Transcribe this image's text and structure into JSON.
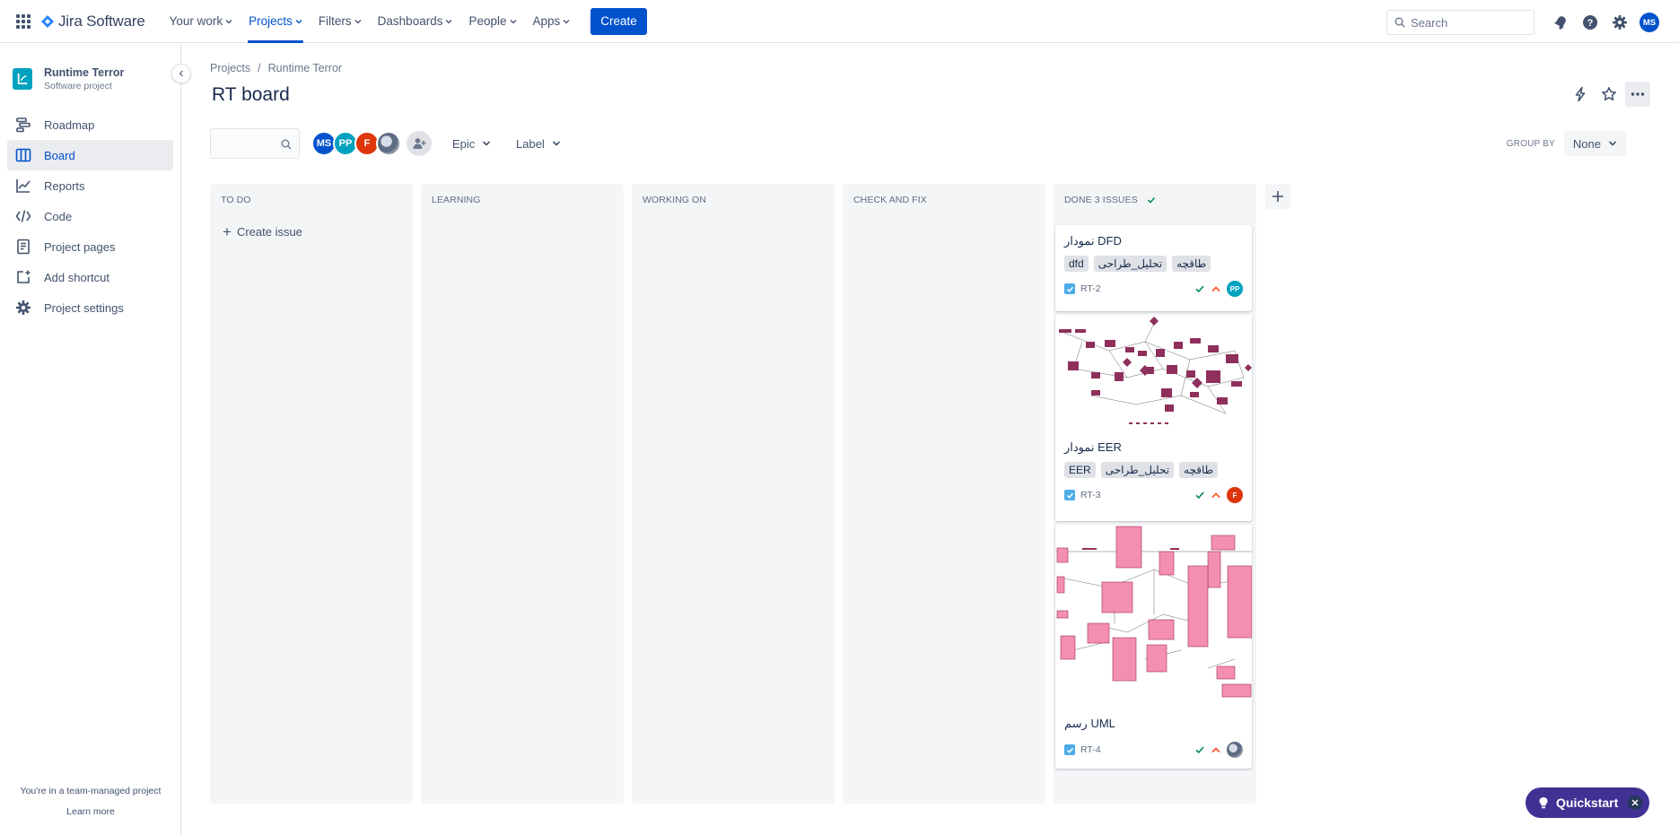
{
  "app": {
    "logo_text": "Jira Software",
    "nav": [
      {
        "label": "Your work"
      },
      {
        "label": "Projects"
      },
      {
        "label": "Filters"
      },
      {
        "label": "Dashboards"
      },
      {
        "label": "People"
      },
      {
        "label": "Apps"
      }
    ],
    "create_label": "Create",
    "search_placeholder": "Search",
    "user_initials": "MS"
  },
  "sidebar": {
    "project_name": "Runtime Terror",
    "project_type": "Software project",
    "items": [
      {
        "label": "Roadmap",
        "icon": "roadmap-icon"
      },
      {
        "label": "Board",
        "icon": "board-icon"
      },
      {
        "label": "Reports",
        "icon": "reports-icon"
      },
      {
        "label": "Code",
        "icon": "code-icon"
      },
      {
        "label": "Project pages",
        "icon": "pages-icon"
      },
      {
        "label": "Add shortcut",
        "icon": "add-shortcut-icon"
      },
      {
        "label": "Project settings",
        "icon": "gear-icon"
      }
    ],
    "footer_text": "You're in a team-managed project",
    "footer_link": "Learn more"
  },
  "main": {
    "breadcrumb": [
      "Projects",
      "Runtime Terror"
    ],
    "title": "RT board",
    "filters": {
      "epic": "Epic",
      "label": "Label",
      "group_by_label": "GROUP BY",
      "group_by_value": "None"
    },
    "members": [
      {
        "initials": "MS",
        "color": "#0052cc"
      },
      {
        "initials": "PP",
        "color": "#00a3bf"
      },
      {
        "initials": "F",
        "color": "#de350b"
      },
      {
        "initials": "",
        "color": "#8993a4"
      }
    ]
  },
  "columns": [
    {
      "name": "TO DO",
      "create_issue": "Create issue"
    },
    {
      "name": "LEARNING"
    },
    {
      "name": "WORKING ON"
    },
    {
      "name": "CHECK AND FIX"
    },
    {
      "name": "DONE 3 ISSUES"
    }
  ],
  "cards": [
    {
      "summary": "نمودار DFD",
      "labels": [
        "dfd",
        "تحلیل_طراحی",
        "طاقچه"
      ],
      "key": "RT-2",
      "assignee": "PP",
      "assignee_color": "#00a3bf"
    },
    {
      "summary": "نمودار EER",
      "labels": [
        "EER",
        "تحلیل_طراحی",
        "طاقچه"
      ],
      "key": "RT-3",
      "assignee": "F",
      "assignee_color": "#de350b"
    },
    {
      "summary": "رسم UML",
      "labels": [],
      "key": "RT-4",
      "assignee": "",
      "assignee_color": "#8993a4"
    }
  ],
  "quickstart": {
    "label": "Quickstart"
  }
}
